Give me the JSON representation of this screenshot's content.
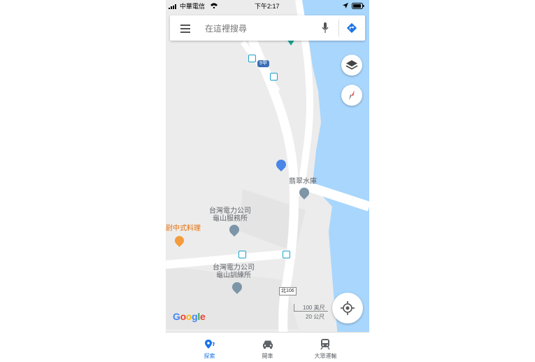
{
  "status_bar": {
    "carrier": "中華電信",
    "time": "下午2:17"
  },
  "search": {
    "placeholder": "在這裡搜尋"
  },
  "map": {
    "road_badge": "9甲",
    "road_label": "北106",
    "places": [
      {
        "name": "翡翠水庫"
      },
      {
        "name_line1": "台灣電力公司",
        "name_line2": "龜山服務所"
      },
      {
        "name": "尉中式料理"
      },
      {
        "name_line1": "台灣電力公司",
        "name_line2": "龜山訓練所"
      }
    ],
    "scale_top": "100 英尺",
    "scale_bottom": "20 公尺",
    "logo": "Google"
  },
  "bottom_nav": [
    {
      "label": "探索",
      "icon": "explore-pin-icon",
      "active": true
    },
    {
      "label": "開車",
      "icon": "car-icon",
      "active": false
    },
    {
      "label": "大眾運輸",
      "icon": "train-icon",
      "active": false
    }
  ],
  "colors": {
    "water": "#a8d6fd",
    "accent": "#1a73e8",
    "road": "#ffffff",
    "land": "#ececec",
    "restaurant": "#f39c3c"
  }
}
